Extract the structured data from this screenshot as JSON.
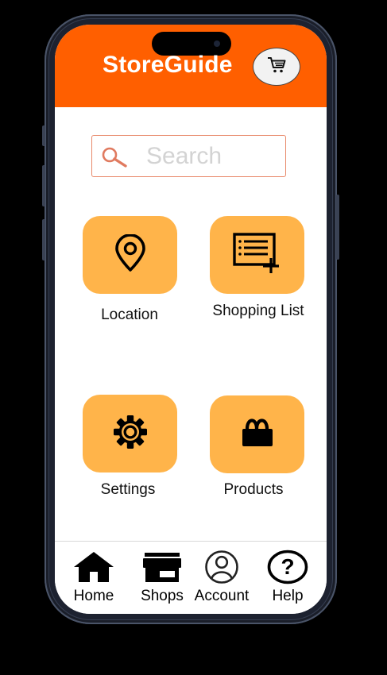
{
  "app": {
    "title": "StoreGuide"
  },
  "header": {
    "cart_icon": "cart-icon"
  },
  "search": {
    "placeholder": "Search",
    "value": "",
    "icon": "search-icon",
    "icon_color": "#e07a5f"
  },
  "tiles": [
    {
      "label": "Location",
      "icon": "map-pin-icon"
    },
    {
      "label": "Shopping List",
      "icon": "list-add-icon"
    },
    {
      "label": "Settings",
      "icon": "gear-icon"
    },
    {
      "label": "Products",
      "icon": "basket-icon"
    }
  ],
  "nav": [
    {
      "label": "Home",
      "icon": "home-icon"
    },
    {
      "label": "Shops",
      "icon": "storefront-icon"
    },
    {
      "label": "Account",
      "icon": "account-icon"
    },
    {
      "label": "Help",
      "icon": "help-icon"
    }
  ],
  "colors": {
    "header": "#ff5f00",
    "tile": "#ffb44a",
    "background": "#ffffff",
    "search_border": "#e8896a"
  }
}
